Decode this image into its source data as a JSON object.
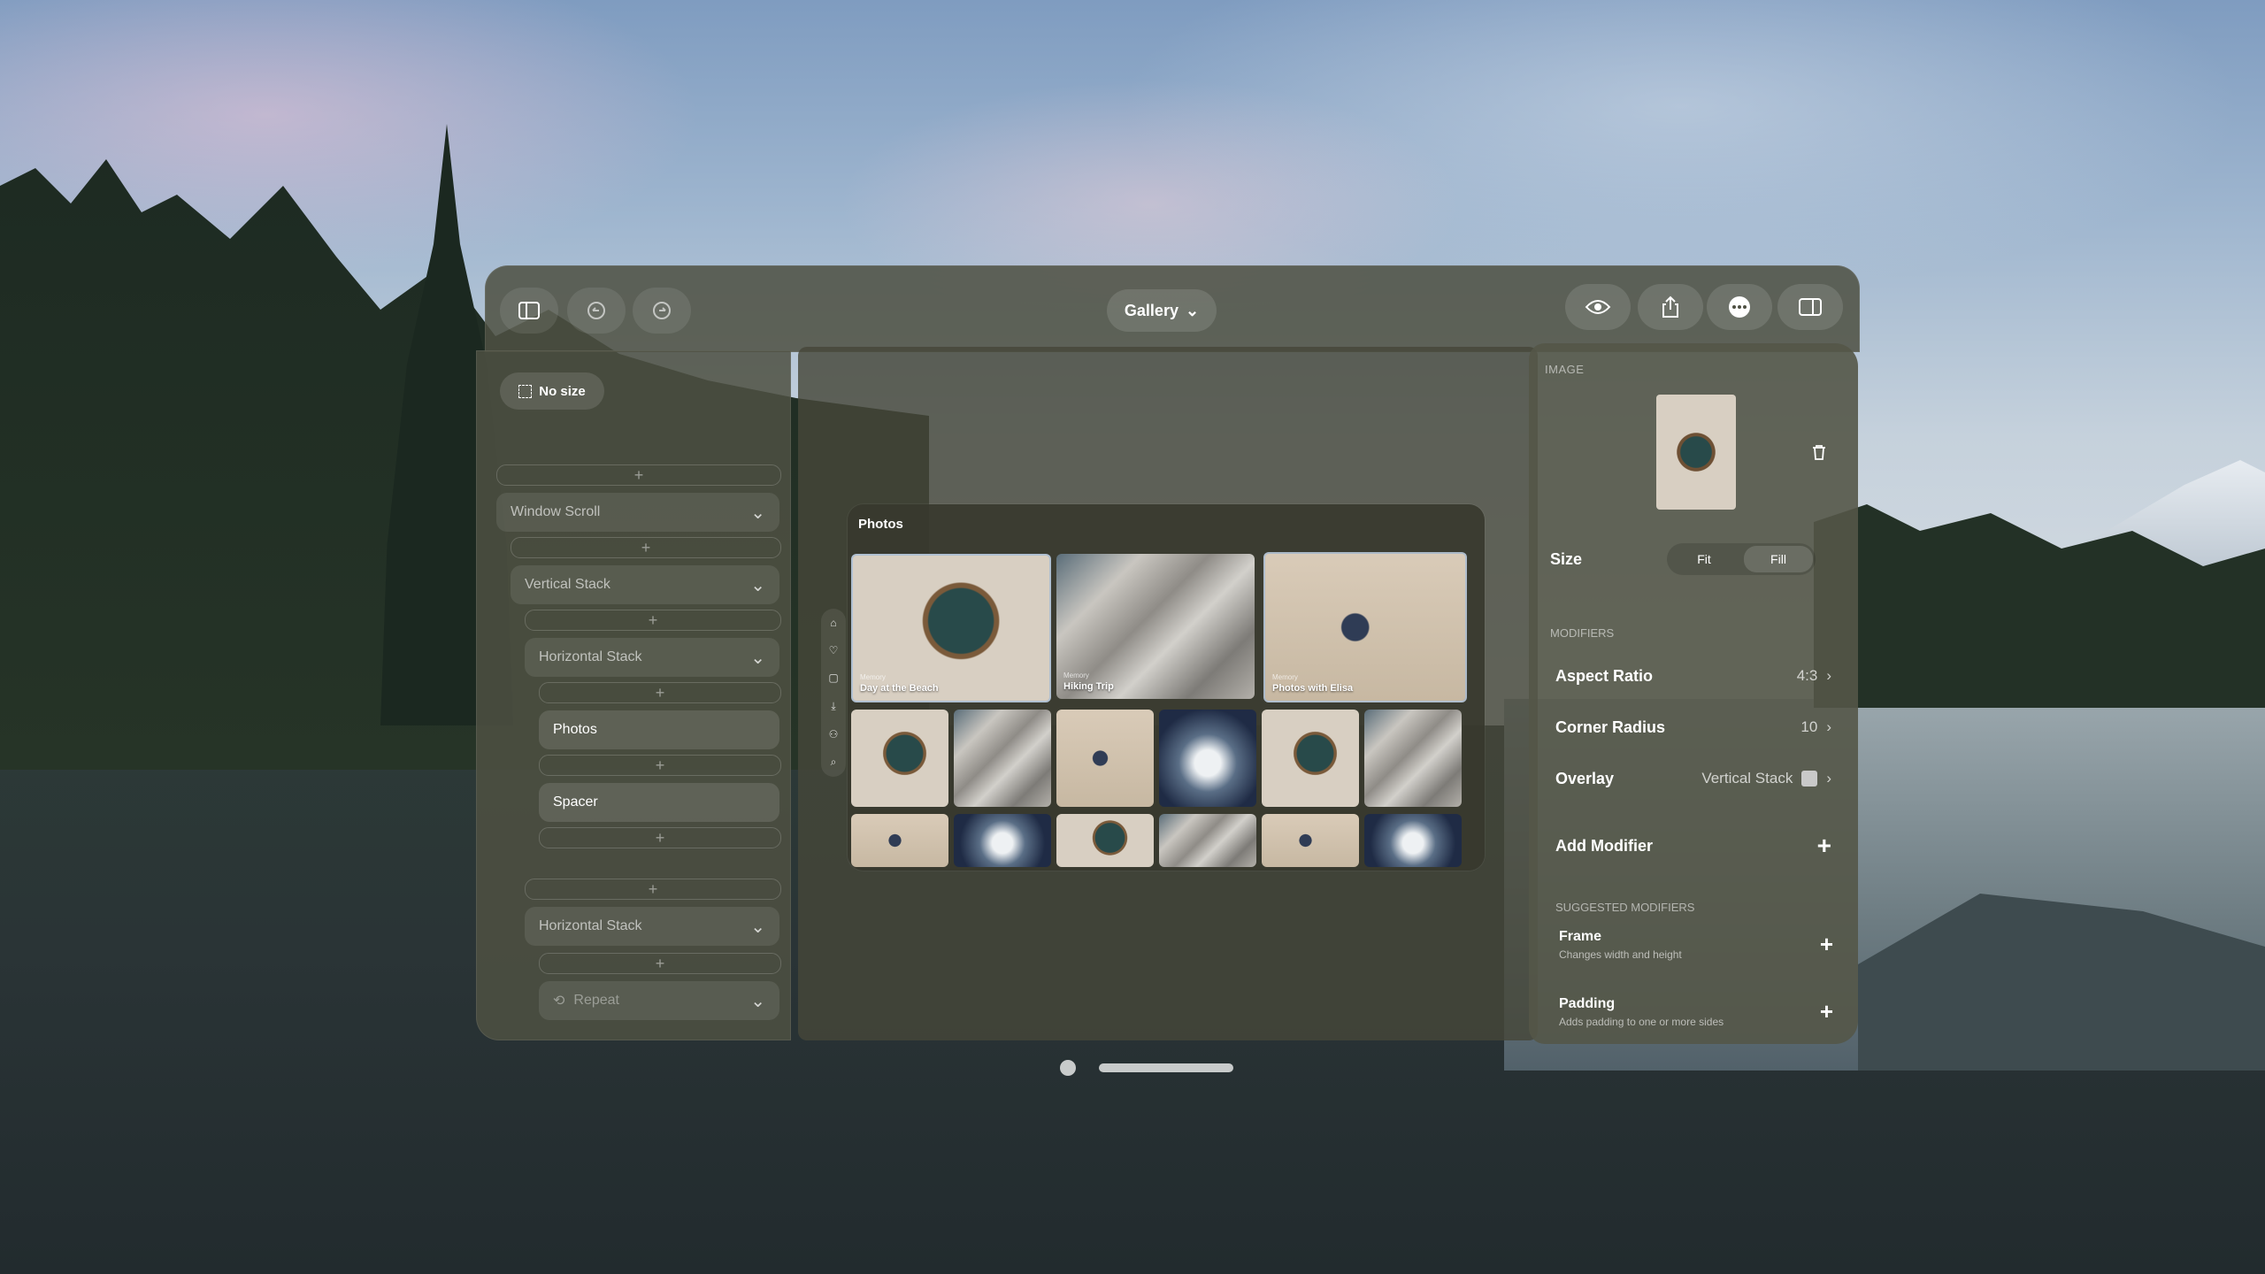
{
  "toolbar": {
    "gallery_label": "Gallery",
    "left_icons": [
      "sidebar-icon",
      "undo-icon",
      "redo-icon"
    ],
    "right_icons": [
      "eye-icon",
      "share-icon",
      "more-icon",
      "inspector-toggle-icon"
    ]
  },
  "tree": {
    "no_size_label": "No size",
    "window_scroll": "Window Scroll",
    "vertical_stack": "Vertical Stack",
    "horizontal_stack_1": "Horizontal Stack",
    "photos": "Photos",
    "spacer": "Spacer",
    "horizontal_stack_2": "Horizontal Stack",
    "repeat": "Repeat",
    "add": "+"
  },
  "canvas": {
    "photos_title": "Photos",
    "tab_icons": [
      "home-icon",
      "heart-icon",
      "bag-icon",
      "download-icon",
      "people-icon",
      "search-icon"
    ],
    "featured": [
      {
        "kicker": "Memory",
        "caption": "Day at the Beach"
      },
      {
        "kicker": "Memory",
        "caption": "Hiking Trip"
      },
      {
        "kicker": "Memory",
        "caption": "Photos with Elisa"
      }
    ]
  },
  "inspector": {
    "section_image": "IMAGE",
    "size_label": "Size",
    "size_options": [
      "Fit",
      "Fill"
    ],
    "size_selected": "Fill",
    "section_modifiers": "MODIFIERS",
    "modifiers": [
      {
        "label": "Aspect Ratio",
        "value": "4:3"
      },
      {
        "label": "Corner Radius",
        "value": "10"
      },
      {
        "label": "Overlay",
        "value": "Vertical Stack"
      }
    ],
    "add_modifier": "Add Modifier",
    "section_suggested": "SUGGESTED MODIFIERS",
    "suggested": [
      {
        "title": "Frame",
        "desc": "Changes width and height"
      },
      {
        "title": "Padding",
        "desc": "Adds padding to one or more sides"
      }
    ]
  }
}
